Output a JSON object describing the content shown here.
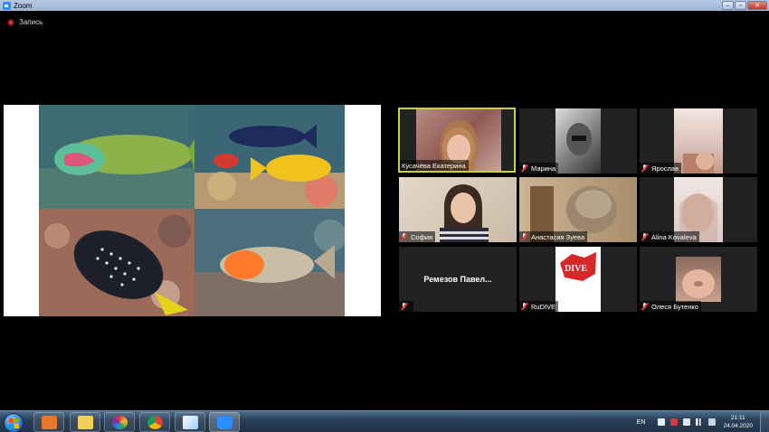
{
  "window": {
    "title": "Zoom",
    "controls": [
      "–",
      "▫",
      "✕"
    ]
  },
  "recording": {
    "label": "Запись"
  },
  "shared_screen": {
    "photos": [
      {
        "icon": "fish-photo-icon"
      },
      {
        "icon": "fish-photo-icon"
      },
      {
        "icon": "fish-photo-icon"
      },
      {
        "icon": "fish-photo-icon"
      }
    ]
  },
  "participants": [
    {
      "name": "Кусачёва Екатерина",
      "active": true,
      "muted": false
    },
    {
      "name": "Марина",
      "active": false,
      "muted": true
    },
    {
      "name": "Ярослав",
      "active": false,
      "muted": true
    },
    {
      "name": "София",
      "active": false,
      "muted": true
    },
    {
      "name": "Анастасия Зуева",
      "active": false,
      "muted": true
    },
    {
      "name": "Alina Kovaleva",
      "active": false,
      "muted": true
    },
    {
      "name": "",
      "center_label": "Ремезов  Павел...",
      "active": false,
      "muted": true
    },
    {
      "name": "RuDIVE",
      "active": false,
      "muted": true
    },
    {
      "name": "Олеся Бутенко",
      "active": false,
      "muted": true
    }
  ],
  "taskbar": {
    "apps": [
      "media-player-icon",
      "folder-icon",
      "picasa-icon",
      "chrome-icon",
      "paint-icon",
      "zoom-icon"
    ],
    "tray": {
      "language": "EN",
      "time": "21:11",
      "date": "24.04.2020"
    }
  },
  "colors": {
    "active_speaker_border": "#c9d13a",
    "muted_red": "#e53935",
    "recording_red": "#e8382f"
  }
}
